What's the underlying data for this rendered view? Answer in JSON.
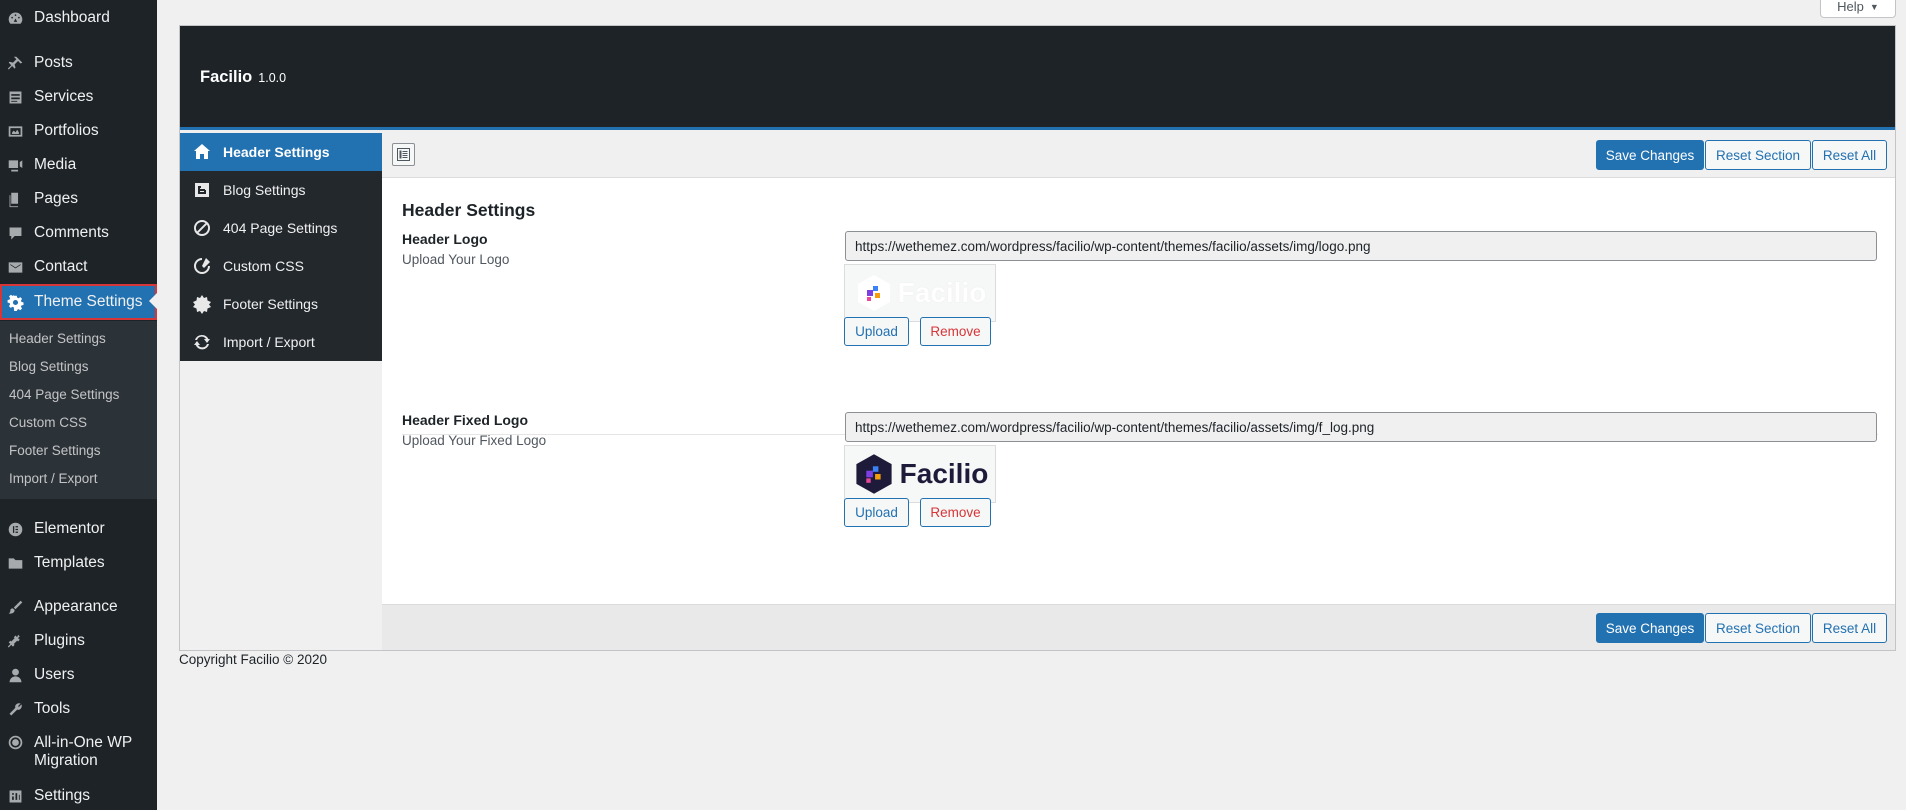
{
  "admin_menu": {
    "items": [
      {
        "label": "Dashboard",
        "icon": "dashboard-icon"
      },
      {
        "label": "Posts",
        "icon": "pin-icon"
      },
      {
        "label": "Services",
        "icon": "list-icon"
      },
      {
        "label": "Portfolios",
        "icon": "portfolio-icon"
      },
      {
        "label": "Media",
        "icon": "media-icon"
      },
      {
        "label": "Pages",
        "icon": "pages-icon"
      },
      {
        "label": "Comments",
        "icon": "comment-icon"
      },
      {
        "label": "Contact",
        "icon": "mail-icon"
      },
      {
        "label": "Theme Settings",
        "icon": "gear-icon"
      },
      {
        "label": "Elementor",
        "icon": "elementor-icon"
      },
      {
        "label": "Templates",
        "icon": "folder-icon"
      },
      {
        "label": "Appearance",
        "icon": "brush-icon"
      },
      {
        "label": "Plugins",
        "icon": "plug-icon"
      },
      {
        "label": "Users",
        "icon": "user-icon"
      },
      {
        "label": "Tools",
        "icon": "wrench-icon"
      },
      {
        "label": "All-in-One WP Migration",
        "icon": "migration-icon"
      },
      {
        "label": "Settings",
        "icon": "settings-icon"
      }
    ],
    "submenu": [
      "Header Settings",
      "Blog Settings",
      "404 Page Settings",
      "Custom CSS",
      "Footer Settings",
      "Import / Export"
    ]
  },
  "help_tab": "Help",
  "panel": {
    "title": "Facilio",
    "version": "1.0.0",
    "nav": [
      {
        "label": "Header Settings",
        "icon": "home-icon"
      },
      {
        "label": "Blog Settings",
        "icon": "blogger-icon"
      },
      {
        "label": "404 Page Settings",
        "icon": "ban-icon"
      },
      {
        "label": "Custom CSS",
        "icon": "css-icon"
      },
      {
        "label": "Footer Settings",
        "icon": "badge-icon"
      },
      {
        "label": "Import / Export",
        "icon": "refresh-icon"
      }
    ],
    "buttons": {
      "save": "Save Changes",
      "reset_section": "Reset Section",
      "reset_all": "Reset All"
    },
    "section_title": "Header Settings",
    "fields": [
      {
        "label": "Header Logo",
        "description": "Upload Your Logo",
        "value": "https://wethemez.com/wordpress/facilio/wp-content/themes/facilio/assets/img/logo.png",
        "logo_text": "Facilio",
        "upload": "Upload",
        "remove": "Remove"
      },
      {
        "label": "Header Fixed Logo",
        "description": "Upload Your Fixed Logo",
        "value": "https://wethemez.com/wordpress/facilio/wp-content/themes/facilio/assets/img/f_log.png",
        "logo_text": "Facilio",
        "upload": "Upload",
        "remove": "Remove"
      }
    ]
  },
  "footer": "Copyright Facilio © 2020"
}
